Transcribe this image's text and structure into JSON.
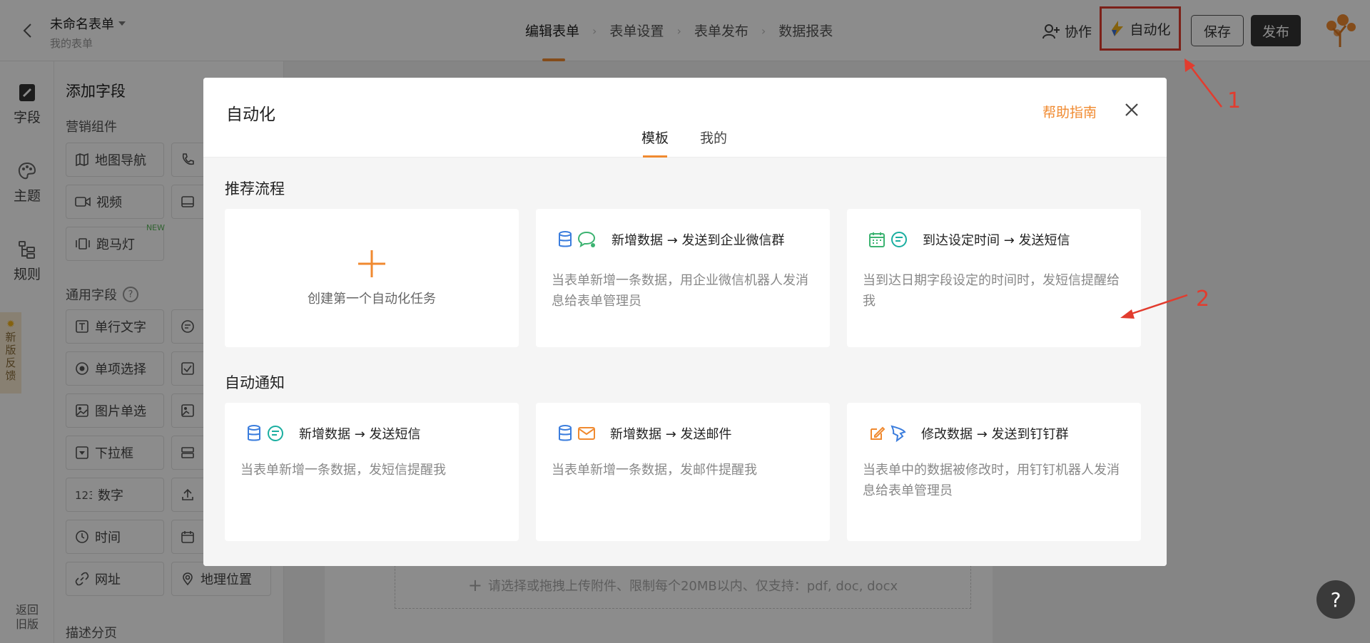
{
  "header": {
    "form_title": "未命名表单",
    "form_subtitle": "我的表单",
    "steps": [
      "编辑表单",
      "表单设置",
      "表单发布",
      "数据报表"
    ],
    "collab_label": "协作",
    "automation_label": "自动化",
    "save_label": "保存",
    "publish_label": "发布"
  },
  "rail": {
    "items": [
      "字段",
      "主题",
      "规则"
    ],
    "feedback": [
      "新",
      "版",
      "反",
      "馈"
    ],
    "old_version": [
      "返回",
      "旧版"
    ]
  },
  "panel": {
    "title": "添加字段",
    "marketing_title": "营销组件",
    "marketing_fields": [
      "地图导航",
      "视频",
      "跑马灯"
    ],
    "new_badge": "NEW",
    "general_title": "通用字段",
    "general_fields": [
      "单行文字",
      "单项选择",
      "图片单选",
      "下拉框",
      "数字",
      "时间",
      "网址"
    ],
    "location_field": "地理位置",
    "desc_title": "描述分页"
  },
  "canvas": {
    "upload_hint": "请选择或拖拽上传附件、限制每个20MB以内、仅支持：pdf, doc, docx"
  },
  "modal": {
    "title": "自动化",
    "help_link": "帮助指南",
    "tabs": [
      "模板",
      "我的"
    ],
    "recommended_title": "推荐流程",
    "create_label": "创建第一个自动化任务",
    "recommended": [
      {
        "name": "新增数据 → 发送到企业微信群",
        "desc": "当表单新增一条数据，用企业微信机器人发消息给表单管理员"
      },
      {
        "name": "到达设定时间 → 发送短信",
        "desc": "当到达日期字段设定的时间时，发短信提醒给我"
      }
    ],
    "notify_title": "自动通知",
    "notify": [
      {
        "name": "新增数据 → 发送短信",
        "desc": "当表单新增一条数据，发短信提醒我"
      },
      {
        "name": "新增数据 → 发送邮件",
        "desc": "当表单新增一条数据，发邮件提醒我"
      },
      {
        "name": "修改数据 → 发送到钉钉群",
        "desc": "当表单中的数据被修改时，用钉钉机器人发消息给表单管理员"
      }
    ]
  },
  "annotations": [
    "1",
    "2"
  ],
  "fab_label": "?",
  "colors": {
    "accent": "#f08a30",
    "annotation": "#e23c2e",
    "dark_button": "#333333",
    "icon_blue": "#3b7ddd",
    "icon_green": "#3cb371"
  }
}
